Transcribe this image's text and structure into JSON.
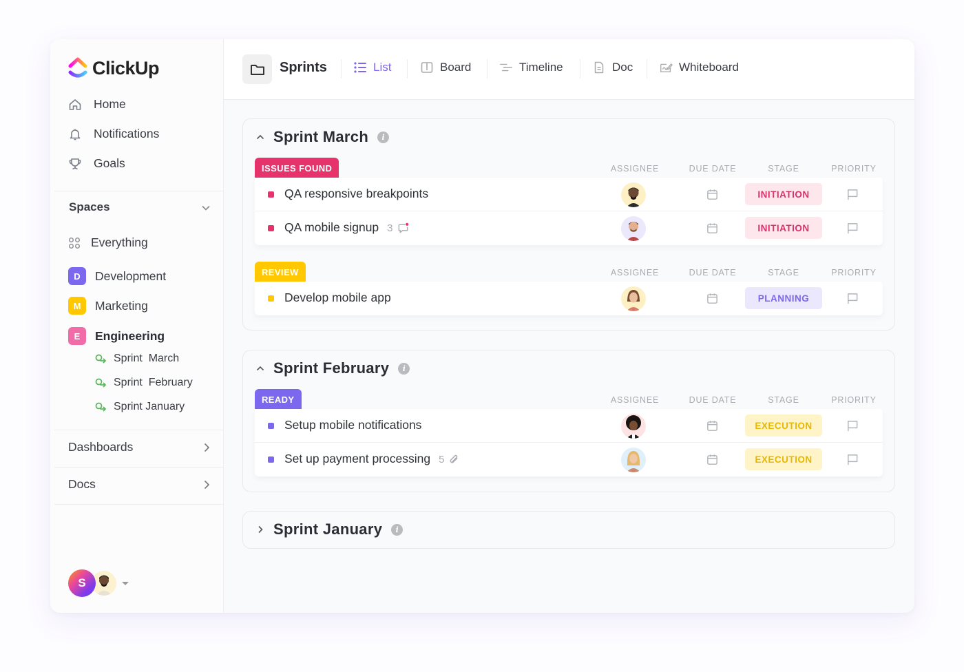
{
  "brand": {
    "name": "ClickUp"
  },
  "sidebar": {
    "nav": [
      {
        "label": "Home",
        "icon": "home-icon"
      },
      {
        "label": "Notifications",
        "icon": "bell-icon"
      },
      {
        "label": "Goals",
        "icon": "trophy-icon"
      }
    ],
    "spaces_label": "Spaces",
    "everything_label": "Everything",
    "spaces": [
      {
        "initial": "D",
        "label": "Development",
        "color": "#7b68ee"
      },
      {
        "initial": "M",
        "label": "Marketing",
        "color": "#ffc800"
      },
      {
        "initial": "E",
        "label": "Engineering",
        "color": "#f06ba8"
      }
    ],
    "sprints": [
      "Sprint  March",
      "Sprint  February",
      "Sprint January"
    ],
    "sections": [
      {
        "label": "Dashboards"
      },
      {
        "label": "Docs"
      }
    ],
    "user_initial": "S"
  },
  "topbar": {
    "breadcrumb": "Sprints",
    "tabs": [
      {
        "label": "List",
        "icon": "list-icon",
        "active": true
      },
      {
        "label": "Board",
        "icon": "board-icon",
        "active": false
      },
      {
        "label": "Timeline",
        "icon": "timeline-icon",
        "active": false
      },
      {
        "label": "Doc",
        "icon": "doc-icon",
        "active": false
      },
      {
        "label": "Whiteboard",
        "icon": "whiteboard-icon",
        "active": false
      }
    ]
  },
  "columns": {
    "assignee": "ASSIGNEE",
    "due_date": "DUE DATE",
    "stage": "STAGE",
    "priority": "PRIORITY"
  },
  "colors": {
    "accent": "#7b68ee",
    "issues_found": "#e6336c",
    "review": "#ffc800",
    "ready": "#7b68ee",
    "initiation_bg": "#fde6ec",
    "initiation_fg": "#d6336c",
    "planning_bg": "#ebe7fd",
    "planning_fg": "#7b68ee",
    "execution_bg": "#fff4c8",
    "execution_fg": "#e8b800"
  },
  "sprints": [
    {
      "title": "Sprint March",
      "expanded": true,
      "groups": [
        {
          "status": "ISSUES FOUND",
          "tasks": [
            {
              "name": "QA responsive breakpoints",
              "stage": "INITIATION"
            },
            {
              "name": "QA mobile signup",
              "stage": "INITIATION",
              "comments": "3"
            }
          ]
        },
        {
          "status": "REVIEW",
          "tasks": [
            {
              "name": "Develop mobile app",
              "stage": "PLANNING"
            }
          ]
        }
      ]
    },
    {
      "title": "Sprint February",
      "expanded": true,
      "groups": [
        {
          "status": "READY",
          "tasks": [
            {
              "name": "Setup mobile notifications",
              "stage": "EXECUTION"
            },
            {
              "name": "Set up payment processing",
              "stage": "EXECUTION",
              "attachments": "5"
            }
          ]
        }
      ]
    },
    {
      "title": "Sprint January",
      "expanded": false
    }
  ]
}
